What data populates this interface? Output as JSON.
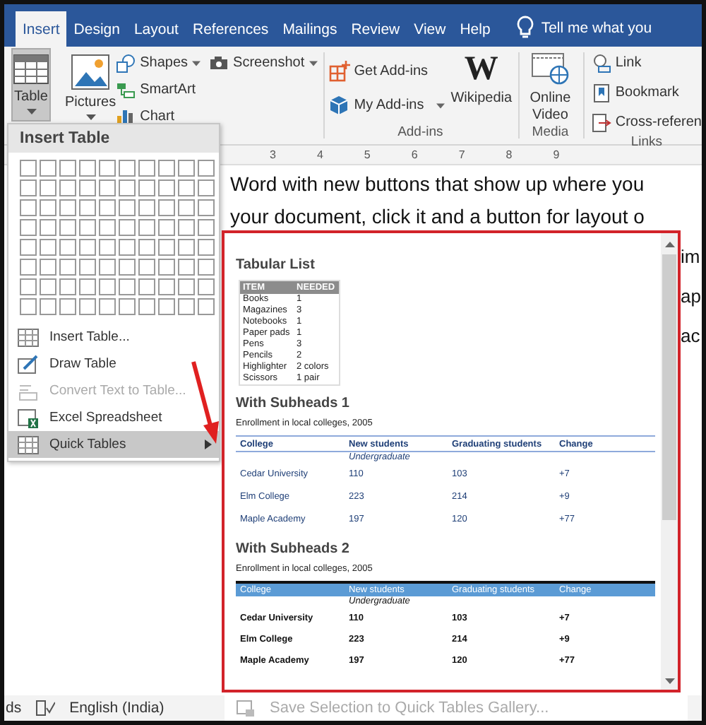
{
  "tabs": [
    {
      "label": "Insert",
      "selected": true
    },
    {
      "label": "Design",
      "selected": false
    },
    {
      "label": "Layout",
      "selected": false
    },
    {
      "label": "References",
      "selected": false
    },
    {
      "label": "Mailings",
      "selected": false
    },
    {
      "label": "Review",
      "selected": false
    },
    {
      "label": "View",
      "selected": false
    },
    {
      "label": "Help",
      "selected": false
    }
  ],
  "tell_me": {
    "label": "Tell me what you"
  },
  "ribbon": {
    "table": {
      "label": "Table",
      "pressed": true
    },
    "pictures": {
      "label": "Pictures"
    },
    "illustrations": [
      {
        "label": "Shapes",
        "kind": "shapes",
        "dropdown": true
      },
      {
        "label": "SmartArt",
        "kind": "smartart",
        "dropdown": false
      },
      {
        "label": "Chart",
        "kind": "chart",
        "dropdown": false
      }
    ],
    "screenshot": {
      "label": "Screenshot"
    },
    "addins": {
      "label": "Add-ins",
      "items": [
        {
          "label": "Get Add-ins",
          "kind": "store",
          "dropdown": false
        },
        {
          "label": "My Add-ins",
          "kind": "myaddins",
          "dropdown": true
        }
      ],
      "wikipedia": {
        "label": "Wikipedia",
        "glyph": "W"
      }
    },
    "media": {
      "label": "Media",
      "items": [
        {
          "label": "Online Video"
        }
      ]
    },
    "links": {
      "label": "Links",
      "items": [
        {
          "label": "Link",
          "kind": "link"
        },
        {
          "label": "Bookmark",
          "kind": "bookmark"
        },
        {
          "label": "Cross-referen",
          "kind": "crossref"
        }
      ]
    }
  },
  "ruler": [
    "3",
    "4",
    "5",
    "6",
    "7",
    "8",
    "9"
  ],
  "document": {
    "lines": [
      "Word with new buttons that show up where you",
      "your document, click it and a button for layout o"
    ],
    "fragments": [
      "im",
      "ap",
      "ac"
    ]
  },
  "insert_table_menu": {
    "title": "Insert Table",
    "items": [
      {
        "label": "Insert Table...",
        "kind": "insert",
        "disabled": false,
        "selected": false,
        "submenu": false
      },
      {
        "label": "Draw Table",
        "kind": "draw",
        "disabled": false,
        "selected": false,
        "submenu": false
      },
      {
        "label": "Convert Text to Table...",
        "kind": "convert",
        "disabled": true,
        "selected": false,
        "submenu": false
      },
      {
        "label": "Excel Spreadsheet",
        "kind": "excel",
        "disabled": false,
        "selected": false,
        "submenu": false
      },
      {
        "label": "Quick Tables",
        "kind": "quick",
        "disabled": false,
        "selected": true,
        "submenu": true
      }
    ]
  },
  "quick_tables_gallery": {
    "sections": [
      {
        "kind": "list",
        "title": "Tabular List",
        "columns": [
          "ITEM",
          "NEEDED"
        ],
        "rows": [
          [
            "Books",
            "1"
          ],
          [
            "Magazines",
            "3"
          ],
          [
            "Notebooks",
            "1"
          ],
          [
            "Paper pads",
            "1"
          ],
          [
            "Pens",
            "3"
          ],
          [
            "Pencils",
            "2"
          ],
          [
            "Highlighter",
            "2 colors"
          ],
          [
            "Scissors",
            "1 pair"
          ]
        ]
      },
      {
        "kind": "lined",
        "title": "With Subheads 1",
        "caption": "Enrollment in local colleges, 2005",
        "columns": [
          "College",
          "New students",
          "Graduating students",
          "Change"
        ],
        "subhead": "Undergraduate",
        "rows": [
          [
            "Cedar University",
            "110",
            "103",
            "+7"
          ],
          [
            "Elm College",
            "223",
            "214",
            "+9"
          ],
          [
            "Maple Academy",
            "197",
            "120",
            "+77"
          ]
        ]
      },
      {
        "kind": "banded",
        "title": "With Subheads 2",
        "caption": "Enrollment in local colleges, 2005",
        "columns": [
          "College",
          "New students",
          "Graduating students",
          "Change"
        ],
        "subhead": "Undergraduate",
        "rows": [
          [
            "Cedar University",
            "110",
            "103",
            "+7"
          ],
          [
            "Elm College",
            "223",
            "214",
            "+9"
          ],
          [
            "Maple Academy",
            "197",
            "120",
            "+77"
          ]
        ]
      }
    ],
    "footer": {
      "label": "Save Selection to Quick Tables Gallery...",
      "disabled": true
    }
  },
  "status_bar": {
    "word_count": "ds",
    "language": "English (India)"
  }
}
